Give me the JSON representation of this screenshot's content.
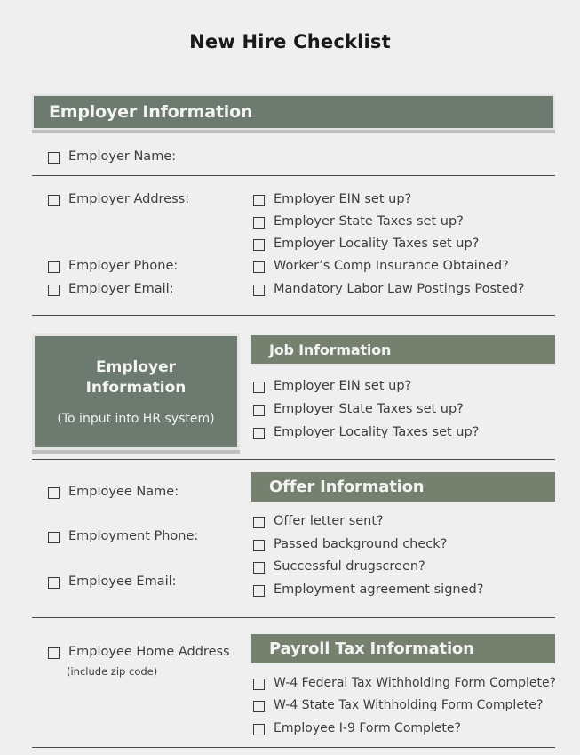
{
  "document": {
    "title": "New Hire Checklist"
  },
  "sections": {
    "employer_information": {
      "band_label": "Employer Information",
      "left_items": [
        {
          "label": "Employer Name:"
        },
        {
          "label": "Employer  Address:"
        },
        {
          "label": "Employer  Phone:"
        },
        {
          "label": "Employer  Email:"
        }
      ],
      "right_items": [
        {
          "label": "Employer  EIN set up?"
        },
        {
          "label": "Employer  State Taxes set up?"
        },
        {
          "label": "Employer  Locality Taxes set up?"
        },
        {
          "label": "Worker’s Comp Insurance Obtained?"
        },
        {
          "label": "Mandatory  Labor  Law Postings  Posted?"
        }
      ]
    },
    "job_information": {
      "callout_title": "Employer Information",
      "callout_subtitle": "(To input into HR system)",
      "band_label": "Job Information",
      "items": [
        {
          "label": "Employer  EIN set up?"
        },
        {
          "label": "Employer  State Taxes set up?"
        },
        {
          "label": "Employer  Locality Taxes set up?"
        }
      ]
    },
    "offer_information": {
      "band_label": "Offer Information",
      "left_items": [
        {
          "label": "Employee  Name:"
        },
        {
          "label": "Employment Phone:"
        },
        {
          "label": "Employee  Email:"
        }
      ],
      "items": [
        {
          "label": "Offer letter sent?"
        },
        {
          "label": "Passed background  check?"
        },
        {
          "label": "Successful drugscreen?"
        },
        {
          "label": "Employment  agreement  signed?"
        }
      ]
    },
    "payroll_tax_information": {
      "band_label": "Payroll Tax Information",
      "left_items": [
        {
          "label": "Employee Home Address"
        }
      ],
      "left_note": "(include  zip code)",
      "items": [
        {
          "label": "W-4 Federal Tax Withholding  Form  Complete?"
        },
        {
          "label": "W-4 State Tax Withholding Form Complete?"
        },
        {
          "label": "Employee  I-9 Form Complete?"
        }
      ]
    }
  },
  "colors": {
    "band_green": "#6c7a70",
    "band_green_light": "#76806f",
    "page_background": "#efefef",
    "rule": "#4a4a4a"
  }
}
